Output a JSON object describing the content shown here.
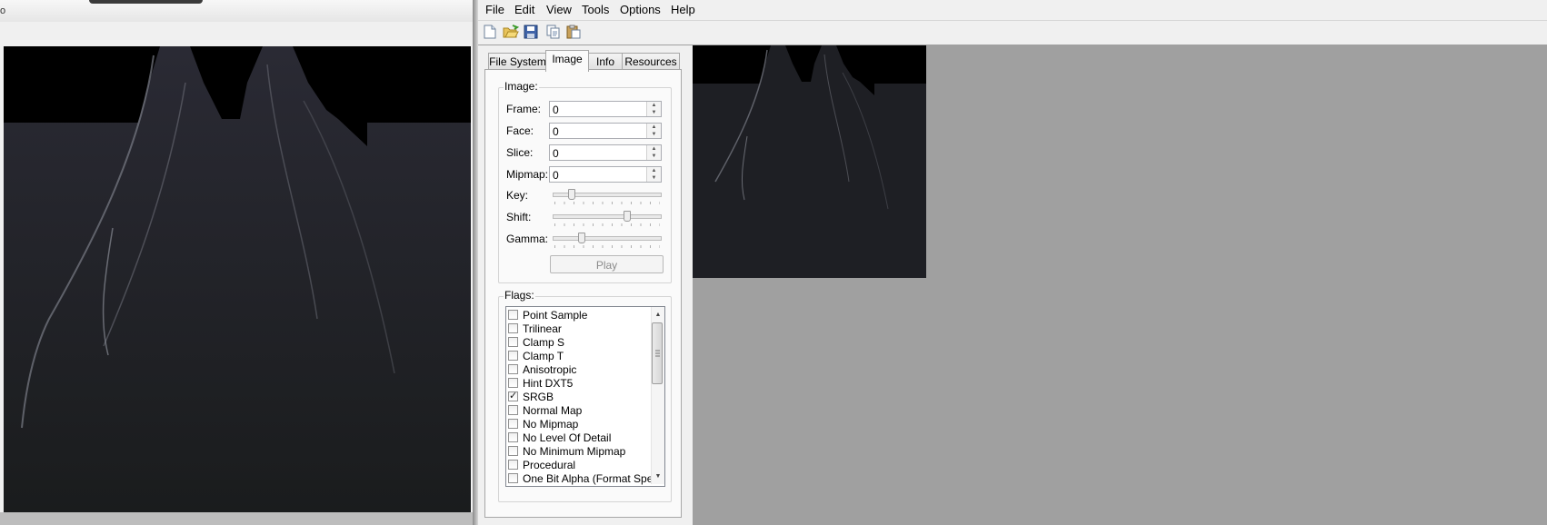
{
  "left_window": {
    "title_fragment": "o"
  },
  "menu": [
    "File",
    "Edit",
    "View",
    "Tools",
    "Options",
    "Help"
  ],
  "toolbar": {
    "icons": [
      "new-file-icon",
      "open-folder-icon",
      "save-icon",
      "copy-icon",
      "paste-icon"
    ]
  },
  "tabs": [
    {
      "label": "File System",
      "active": false
    },
    {
      "label": "Image",
      "active": true
    },
    {
      "label": "Info",
      "active": false
    },
    {
      "label": "Resources",
      "active": false
    }
  ],
  "image_group": {
    "label": "Image:",
    "frame": {
      "label": "Frame:",
      "value": "0"
    },
    "face": {
      "label": "Face:",
      "value": "0"
    },
    "slice": {
      "label": "Slice:",
      "value": "0"
    },
    "mipmap": {
      "label": "Mipmap:",
      "value": "0"
    },
    "key": {
      "label": "Key:",
      "position": 0.15
    },
    "shift": {
      "label": "Shift:",
      "position": 0.7
    },
    "gamma": {
      "label": "Gamma:",
      "position": 0.25
    },
    "play_label": "Play",
    "play_enabled": false
  },
  "flags_group": {
    "label": "Flags:",
    "items": [
      {
        "label": "Point Sample",
        "checked": false
      },
      {
        "label": "Trilinear",
        "checked": false
      },
      {
        "label": "Clamp S",
        "checked": false
      },
      {
        "label": "Clamp T",
        "checked": false
      },
      {
        "label": "Anisotropic",
        "checked": false
      },
      {
        "label": "Hint DXT5",
        "checked": false
      },
      {
        "label": "SRGB",
        "checked": true
      },
      {
        "label": "Normal Map",
        "checked": false
      },
      {
        "label": "No Mipmap",
        "checked": false
      },
      {
        "label": "No Level Of Detail",
        "checked": false
      },
      {
        "label": "No Minimum Mipmap",
        "checked": false
      },
      {
        "label": "Procedural",
        "checked": false
      },
      {
        "label": "One Bit Alpha (Format Spec",
        "checked": false
      }
    ]
  },
  "colors": {
    "window_bg": "#f0f0f0",
    "preview_bg": "#a0a0a0",
    "texture_dark": "#1b1b20"
  }
}
